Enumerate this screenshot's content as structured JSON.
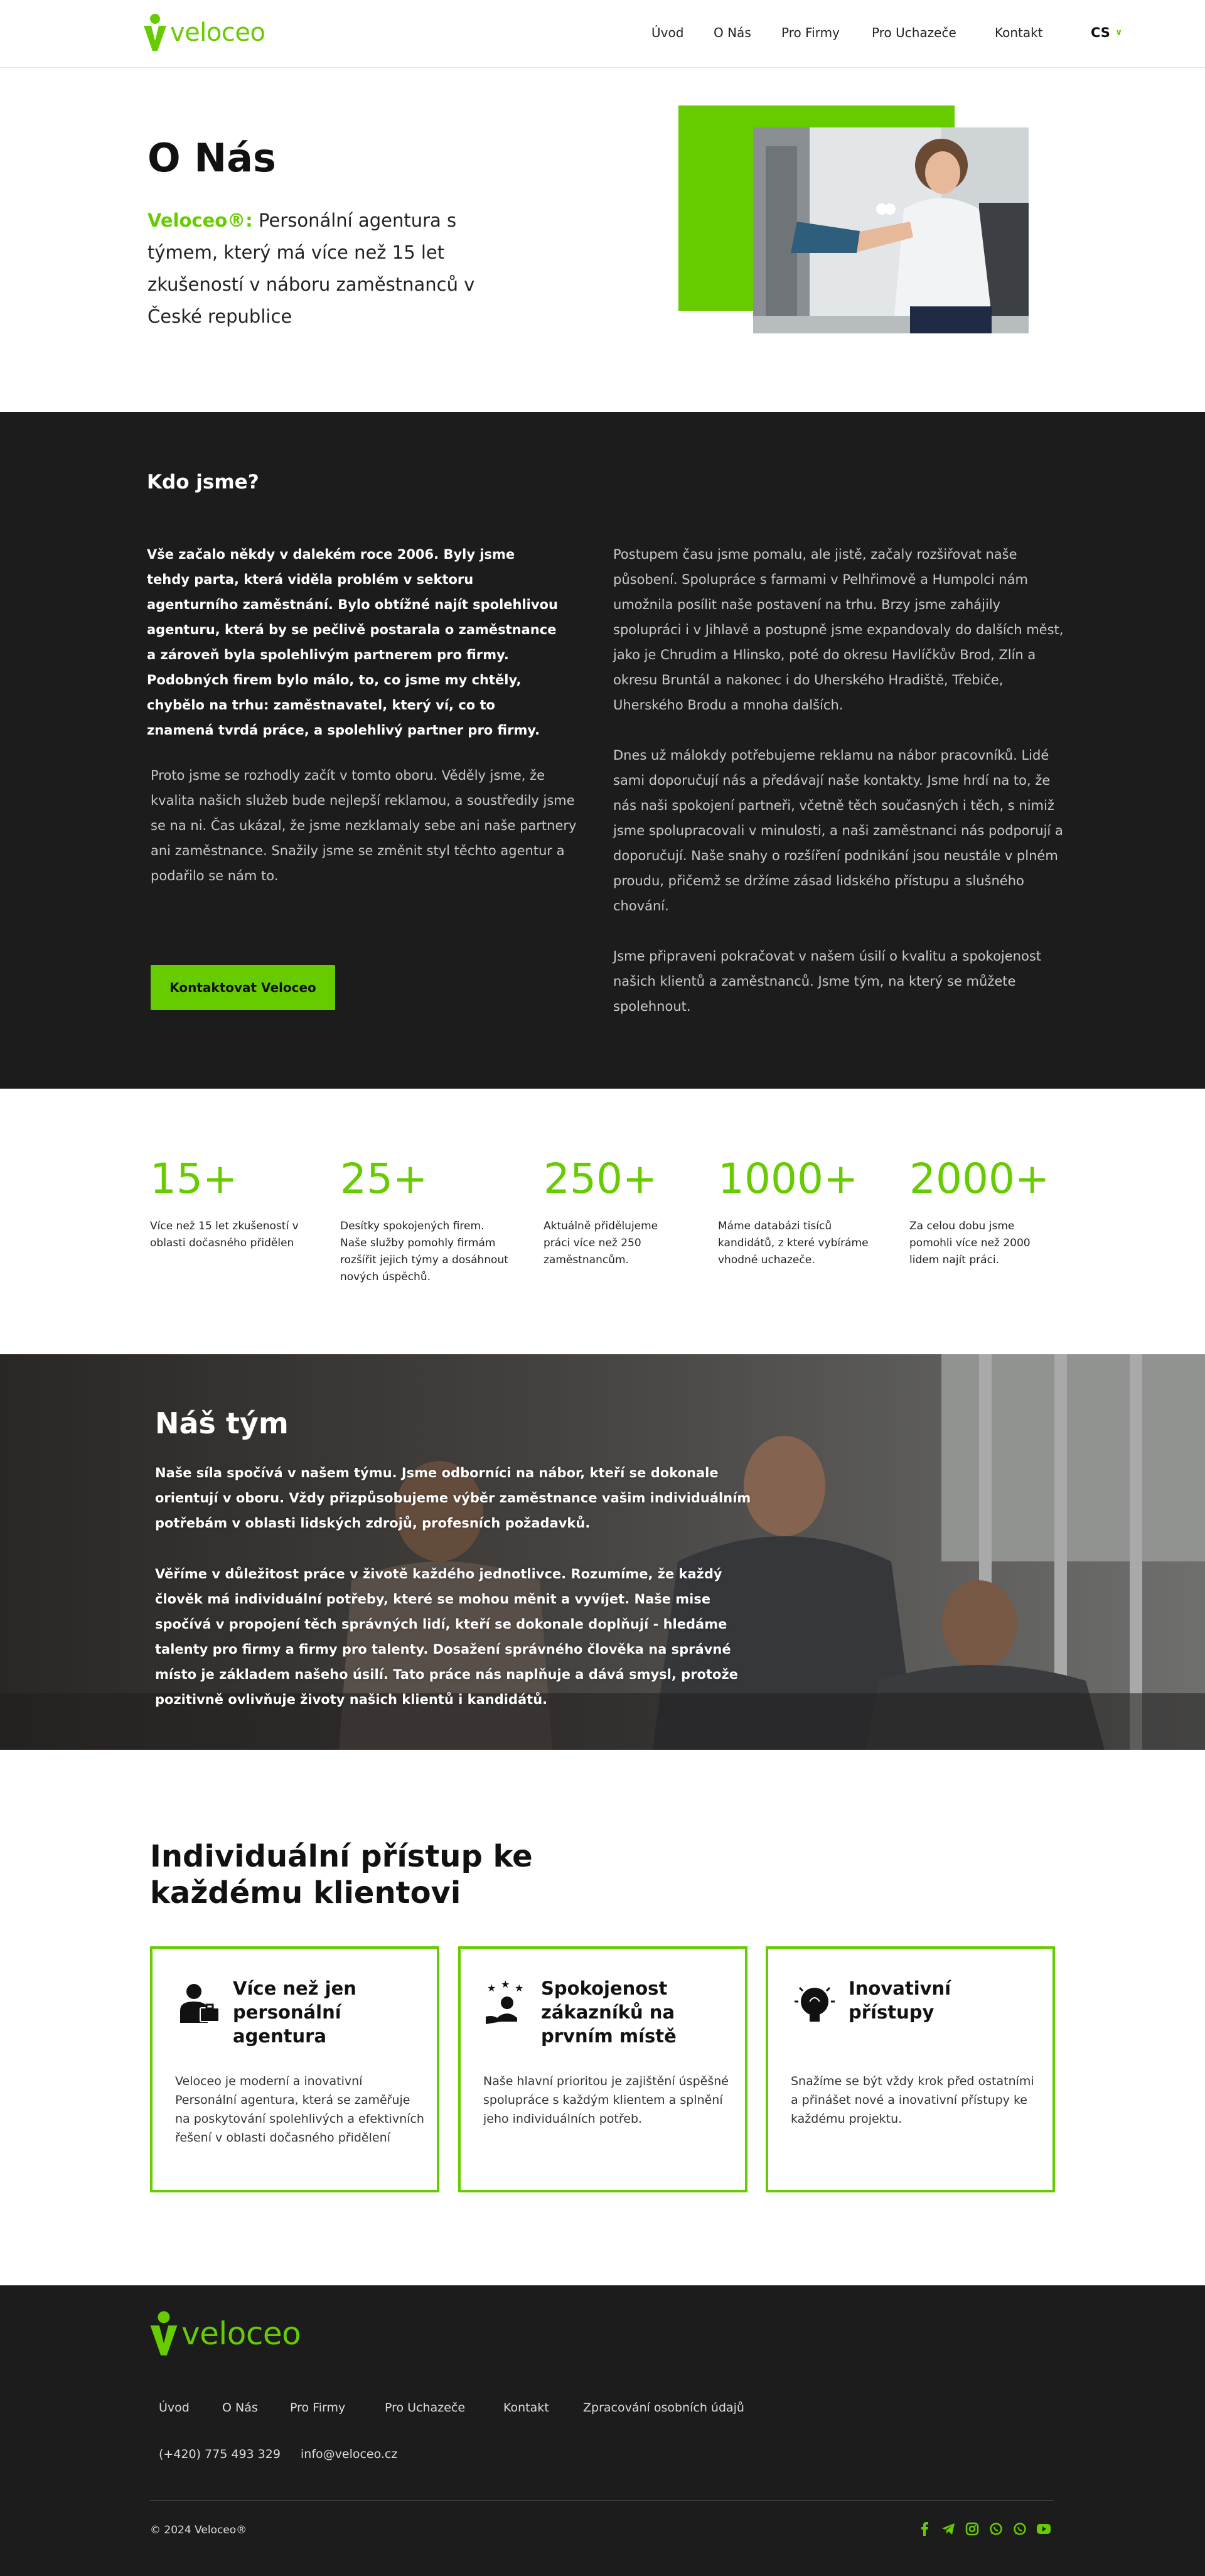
{
  "nav": {
    "logo_text": "veloceo",
    "items": [
      {
        "label": "Úvod"
      },
      {
        "label": "O Nás"
      },
      {
        "label": "Pro Firmy"
      },
      {
        "label": "Pro Uchazeče"
      },
      {
        "label": "Kontakt"
      }
    ],
    "language": "CS"
  },
  "hero": {
    "title": "O Nás",
    "brand": "Veloceo®:",
    "subtitle": " Personální agentura s týmem, který má více než 15 let zkušeností v náboru zaměstnanců v České republice"
  },
  "about": {
    "title": "Kdo jsme?",
    "left_bold": "Vše začalo někdy v dalekém roce 2006. Byly jsme tehdy parta, která viděla problém v sektoru agenturního zaměstnání. Bylo obtížné najít spolehlivou agenturu, která by se pečlivě postarala o zaměstnance a zároveň byla spolehlivým partnerem pro firmy. Podobných firem bylo málo, to, co jsme my chtěly, chybělo na trhu: zaměstnavatel, který ví, co to znamená tvrdá práce, a spolehlivý partner pro firmy.",
    "left_p": "Proto jsme se rozhodly začít v tomto oboru. Věděly jsme, že kvalita našich služeb bude nejlepší reklamou, a soustředily jsme se na ni. Čas ukázal, že jsme nezklamaly sebe ani naše partnery ani zaměstnance. Snažily jsme se změnit styl těchto agentur a podařilo se nám to.",
    "right_p1": "Postupem času jsme pomalu, ale jistě, začaly rozšiřovat naše působení. Spolupráce s farmami v Pelhřimově a Humpolci nám umožnila posílit naše postavení na trhu. Brzy jsme zahájily spolupráci i v Jihlavě a postupně jsme expandovaly do dalších měst, jako je Chrudim a Hlinsko, poté do okresu Havlíčkův Brod, Zlín a okresu Bruntál a nakonec i do Uherského Hradiště, Třebiče, Uherského Brodu a mnoha dalších.",
    "right_p2": "Dnes už málokdy potřebujeme reklamu na nábor pracovníků. Lidé sami doporučují nás a předávají naše kontakty. Jsme hrdí na to, že nás naši spokojení partneři, včetně těch současných i těch, s nimiž jsme spolupracovali v minulosti, a naši zaměstnanci nás podporují a doporučují. Naše snahy o rozšíření podnikání jsou neustále v plném proudu, přičemž se držíme zásad lidského přístupu a slušného chování.",
    "right_p3": "Jsme připraveni pokračovat v našem úsilí o kvalitu a spokojenost našich klientů a zaměstnanců. Jsme tým, na který se můžete spolehnout.",
    "cta": "Kontaktovat Veloceo"
  },
  "stats": [
    {
      "num": "15+",
      "desc": "Více než 15 let zkušeností v oblasti dočasného přidělen"
    },
    {
      "num": "25+",
      "desc": "Desítky spokojených firem. Naše služby pomohly firmám rozšířit jejich týmy a dosáhnout nových úspěchů."
    },
    {
      "num": "250+",
      "desc": "Aktuálně přidělujeme práci více než 250 zaměstnancům."
    },
    {
      "num": "1000+",
      "desc": "Máme databázi tisíců kandidátů, z které vybíráme vhodné uchazeče."
    },
    {
      "num": "2000+",
      "desc": "Za celou dobu jsme pomohli více než 2000 lidem najít práci."
    }
  ],
  "team": {
    "title": "Náš tým",
    "p1": "Naše síla spočívá v našem týmu. Jsme odborníci na nábor, kteří se dokonale orientují v oboru. Vždy přizpůsobujeme výběr zaměstnance vašim individuálním potřebám v oblasti lidských zdrojů, profesních požadavků.",
    "p2": "Věříme v důležitost práce v životě každého jednotlivce. Rozumíme, že každý člověk má individuální potřeby, které se mohou měnit a vyvíjet. Naše mise spočívá v propojení těch správných lidí, kteří se dokonale doplňují - hledáme talenty pro firmy a firmy pro talenty. Dosažení správného člověka na správné místo je základem našeho úsilí. Tato práce nás naplňuje a dává smysl, protože pozitivně ovlivňuje životy našich klientů i kandidátů."
  },
  "approach": {
    "title": "Individuální přístup ke každému klientovi",
    "cards": [
      {
        "icon": "businessman-icon",
        "title": "Více než jen personální agentura",
        "text": "Veloceo je moderní a inovativní Personální agentura, která se zaměřuje na poskytování spolehlivých a efektivních řešení v oblasti dočasného přidělení"
      },
      {
        "icon": "satisfied-customers-icon",
        "title": "Spokojenost zákazníků na prvním místě",
        "text": "Naše hlavní prioritou je zajištění úspěšné spolupráce s každým klientem a splnění jeho individuálních potřeb."
      },
      {
        "icon": "lightbulb-brain-icon",
        "title": "Inovativní přístupy",
        "text": "Snažíme se být vždy krok před ostatními a přinášet nové a inovativní přístupy ke každému projektu."
      }
    ]
  },
  "footer": {
    "logo_text": "veloceo",
    "links": [
      {
        "label": "Úvod"
      },
      {
        "label": "O Nás"
      },
      {
        "label": "Pro Firmy"
      },
      {
        "label": "Pro Uchazeče"
      },
      {
        "label": "Kontakt"
      },
      {
        "label": "Zpracování osobních údajů"
      }
    ],
    "phone": "(+420) 775 493 329",
    "email": "info@veloceo.cz",
    "copyright": "© 2024 Veloceo®",
    "social": [
      "facebook-icon",
      "telegram-icon",
      "instagram-icon",
      "whatsapp-icon",
      "whatsapp-business-icon",
      "youtube-icon"
    ]
  },
  "colors": {
    "accent": "#66cc00",
    "dark": "#1c1c1c"
  }
}
